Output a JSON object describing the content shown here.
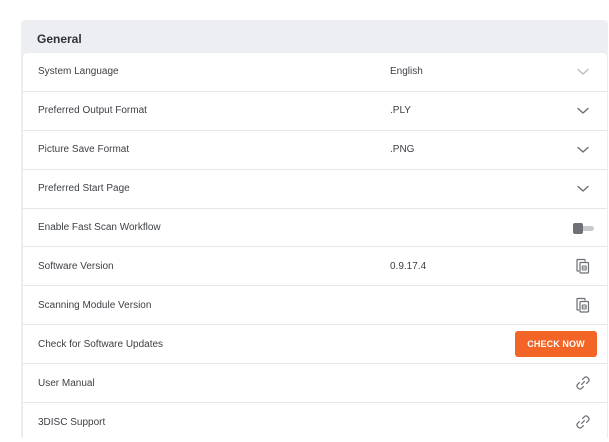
{
  "section": {
    "title": "General"
  },
  "rows": [
    {
      "label": "System Language",
      "value": "English",
      "action": "chevron-down-icon",
      "disabled": true
    },
    {
      "label": "Preferred Output Format",
      "value": ".PLY",
      "action": "chevron-down-icon"
    },
    {
      "label": "Picture Save Format",
      "value": ".PNG",
      "action": "chevron-down-icon"
    },
    {
      "label": "Preferred Start Page",
      "value": "",
      "action": "chevron-down-icon"
    },
    {
      "label": "Enable Fast Scan Workflow",
      "value": "",
      "action": "toggle",
      "toggle_on": false
    },
    {
      "label": "Software Version",
      "value": "0.9.17.4",
      "action": "copy-icon"
    },
    {
      "label": "Scanning Module Version",
      "value": "",
      "action": "copy-icon"
    },
    {
      "label": "Check for Software Updates",
      "value": "",
      "action": "button",
      "button_label": "CHECK NOW"
    },
    {
      "label": "User Manual",
      "value": "",
      "action": "link-icon"
    },
    {
      "label": "3DISC Support",
      "value": "",
      "action": "link-icon"
    }
  ],
  "colors": {
    "accent": "#f26526",
    "panel_bg": "#eceef2",
    "card_bg": "#ffffff",
    "divider": "#e4e6ea",
    "icon": "#6b6e73",
    "icon_disabled": "#b9bbbf"
  }
}
